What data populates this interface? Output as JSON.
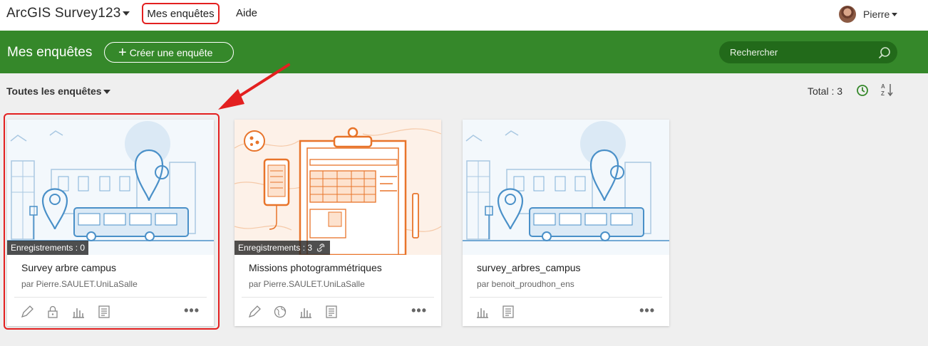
{
  "app": {
    "title": "ArcGIS Survey123"
  },
  "nav": {
    "my_surveys": "Mes enquêtes",
    "help": "Aide"
  },
  "user": {
    "name": "Pierre"
  },
  "header": {
    "title": "Mes enquêtes",
    "create_label": "Créer une enquête",
    "search_placeholder": "Rechercher"
  },
  "filter": {
    "label": "Toutes les enquêtes",
    "total": "Total : 3"
  },
  "colors": {
    "brand_green": "#35882a",
    "annotation_red": "#e32020",
    "illustration_blue": "#4a90c8",
    "illustration_orange": "#e8742a"
  },
  "cards": [
    {
      "title": "Survey arbre campus",
      "owner": "par Pierre.SAULET.UniLaSalle",
      "records": "Enregistrements : 0",
      "shared_icon": "",
      "thumbnail": "city-bus-map-pin",
      "actions": [
        "pencil-icon",
        "lock-icon",
        "bar-chart-icon",
        "document-icon"
      ]
    },
    {
      "title": "Missions photogrammétriques",
      "owner": "par Pierre.SAULET.UniLaSalle",
      "records": "Enregistrements : 3",
      "shared_icon": "link-icon",
      "thumbnail": "clipboard-phone-form",
      "actions": [
        "pencil-icon",
        "globe-icon",
        "bar-chart-icon",
        "document-icon"
      ]
    },
    {
      "title": "survey_arbres_campus",
      "owner": "par benoit_proudhon_ens",
      "records": "",
      "shared_icon": "",
      "thumbnail": "city-bus-map-pin",
      "actions": [
        "bar-chart-icon",
        "document-icon"
      ]
    }
  ]
}
